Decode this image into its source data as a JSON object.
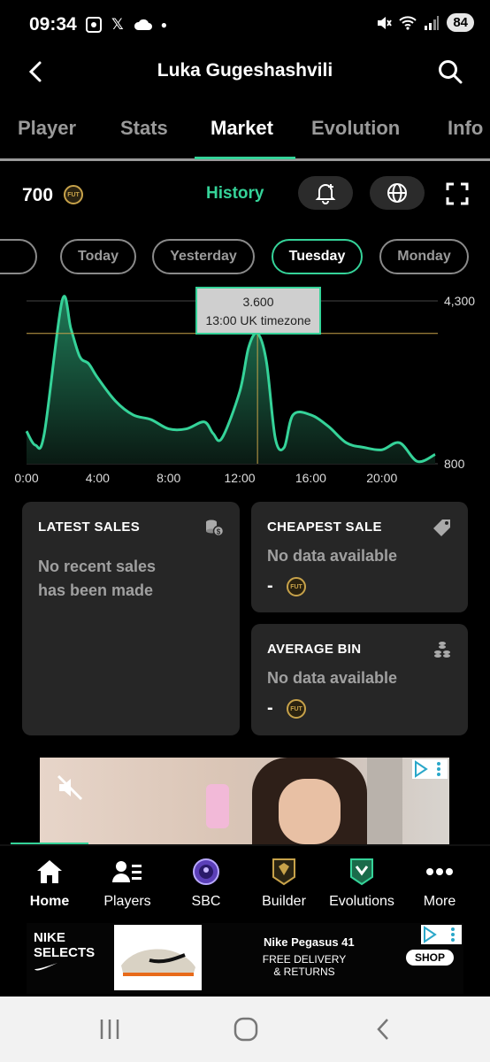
{
  "status_bar": {
    "time": "09:34",
    "battery": "84"
  },
  "header": {
    "title": "Luka Gugeshashvili"
  },
  "tabs": [
    {
      "label": "Player"
    },
    {
      "label": "Stats"
    },
    {
      "label": "Market"
    },
    {
      "label": "Evolution"
    },
    {
      "label": "Info"
    }
  ],
  "price": {
    "value": "700",
    "coin_label": "FUT"
  },
  "history_label": "History",
  "days": [
    {
      "label": "Today"
    },
    {
      "label": "Yesterday"
    },
    {
      "label": "Tuesday"
    },
    {
      "label": "Monday"
    }
  ],
  "tooltip": {
    "value": "3.600",
    "caption": "13:00 UK timezone"
  },
  "chart_data": {
    "type": "area",
    "x_ticks": [
      "0:00",
      "4:00",
      "8:00",
      "12:00",
      "16:00",
      "20:00"
    ],
    "y_ticks": [
      "4,300",
      "800"
    ],
    "ylim": [
      800,
      4300
    ],
    "xlim": [
      0,
      23
    ],
    "points": [
      [
        0,
        1500
      ],
      [
        0.5,
        1200
      ],
      [
        1,
        1450
      ],
      [
        2,
        4300
      ],
      [
        2.5,
        3700
      ],
      [
        3,
        3100
      ],
      [
        3.5,
        2950
      ],
      [
        4,
        2650
      ],
      [
        5,
        2150
      ],
      [
        6,
        1850
      ],
      [
        7,
        1750
      ],
      [
        8,
        1550
      ],
      [
        9,
        1550
      ],
      [
        10,
        1700
      ],
      [
        10.5,
        1450
      ],
      [
        11,
        1350
      ],
      [
        12,
        2350
      ],
      [
        12.5,
        3300
      ],
      [
        13,
        3600
      ],
      [
        13.5,
        3000
      ],
      [
        14,
        1350
      ],
      [
        14.5,
        1150
      ],
      [
        15,
        1850
      ],
      [
        16,
        1850
      ],
      [
        17,
        1600
      ],
      [
        18,
        1250
      ],
      [
        19,
        1150
      ],
      [
        20,
        1100
      ],
      [
        21,
        1250
      ],
      [
        22,
        850
      ],
      [
        23,
        1000
      ]
    ],
    "highlight": {
      "x": 13,
      "y": 3600
    }
  },
  "latest_sales": {
    "title": "LATEST SALES",
    "body": "No recent sales has been made"
  },
  "cheapest_sale": {
    "title": "CHEAPEST SALE",
    "body": "No data available",
    "value": "-"
  },
  "average_bin": {
    "title": "AVERAGE BIN",
    "body": "No data available",
    "value": "-"
  },
  "bottom_nav": [
    {
      "label": "Home"
    },
    {
      "label": "Players"
    },
    {
      "label": "SBC"
    },
    {
      "label": "Builder"
    },
    {
      "label": "Evolutions"
    },
    {
      "label": "More"
    }
  ],
  "ad_bottom": {
    "brand_line1": "NIKE",
    "brand_line2": "SELECTS",
    "title": "Nike Pegasus 41",
    "sub_line1": "FREE DELIVERY",
    "sub_line2": "& RETURNS",
    "cta": "SHOP"
  },
  "colors": {
    "accent": "#35d399",
    "card": "#262626",
    "coin": "#c7a24a"
  }
}
